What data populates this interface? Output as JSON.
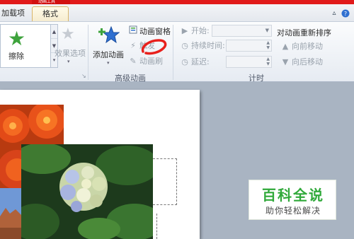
{
  "tabs": {
    "addins": "加载项",
    "format": "格式",
    "contextual_partial": "动画工具"
  },
  "ribbon": {
    "effects_gallery": {
      "item_label": "擦除",
      "options_label": "效果选项"
    },
    "advanced_animation": {
      "add_animation": "添加动画",
      "animation_pane": "动画窗格",
      "trigger": "触发",
      "animation_painter": "动画刷",
      "group_label": "高级动画"
    },
    "timing": {
      "start_label": "开始:",
      "start_value": "",
      "duration_label": "持续时间:",
      "duration_value": "",
      "delay_label": "延迟:",
      "delay_value": "",
      "group_label": "计时"
    },
    "reorder": {
      "title": "对动画重新排序",
      "move_earlier": "向前移动",
      "move_later": "向后移动"
    }
  },
  "watermark": {
    "title": "百科全说",
    "subtitle": "助你轻松解决"
  },
  "colors": {
    "accent_red": "#e11a1a",
    "star_green": "#3ea33c",
    "star_blue": "#2f6fd0",
    "annotation_red": "#e8201c",
    "watermark_green": "#30a93a"
  },
  "icons": [
    "star-green-icon",
    "star-grey-icon",
    "add-animation-star-icon",
    "animation-pane-icon",
    "trigger-icon",
    "animation-painter-icon",
    "triangle-right-icon",
    "clock-icon",
    "up-arrow-icon",
    "down-arrow-icon"
  ]
}
